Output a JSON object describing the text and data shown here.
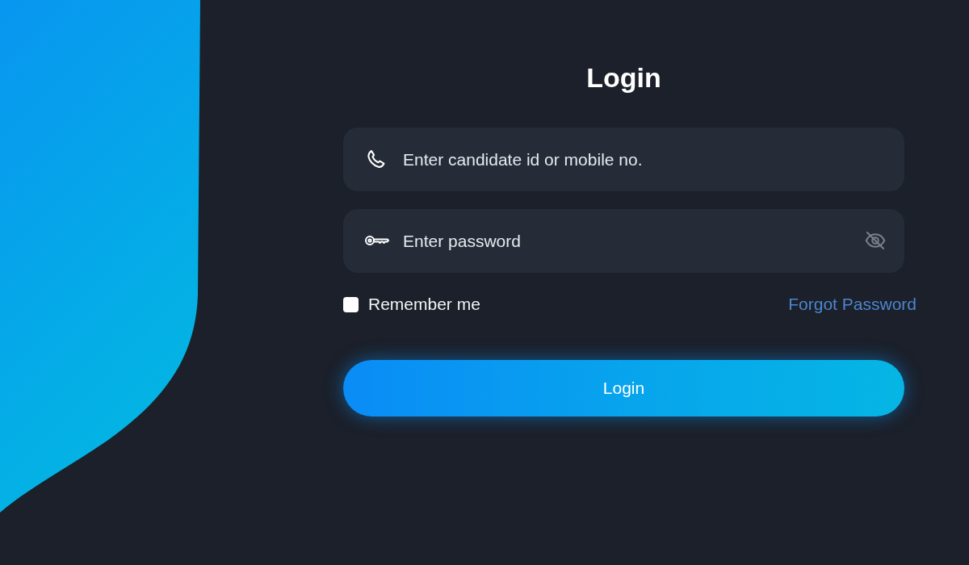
{
  "title": "Login",
  "fields": [
    {
      "kind": "phone",
      "placeholder": "Enter candidate id or mobile no."
    },
    {
      "kind": "password",
      "placeholder": "Enter password"
    }
  ],
  "remember_me": {
    "label": "Remember me",
    "checked": false
  },
  "forgot_password_link": "Forgot Password",
  "login_button": "Login"
}
